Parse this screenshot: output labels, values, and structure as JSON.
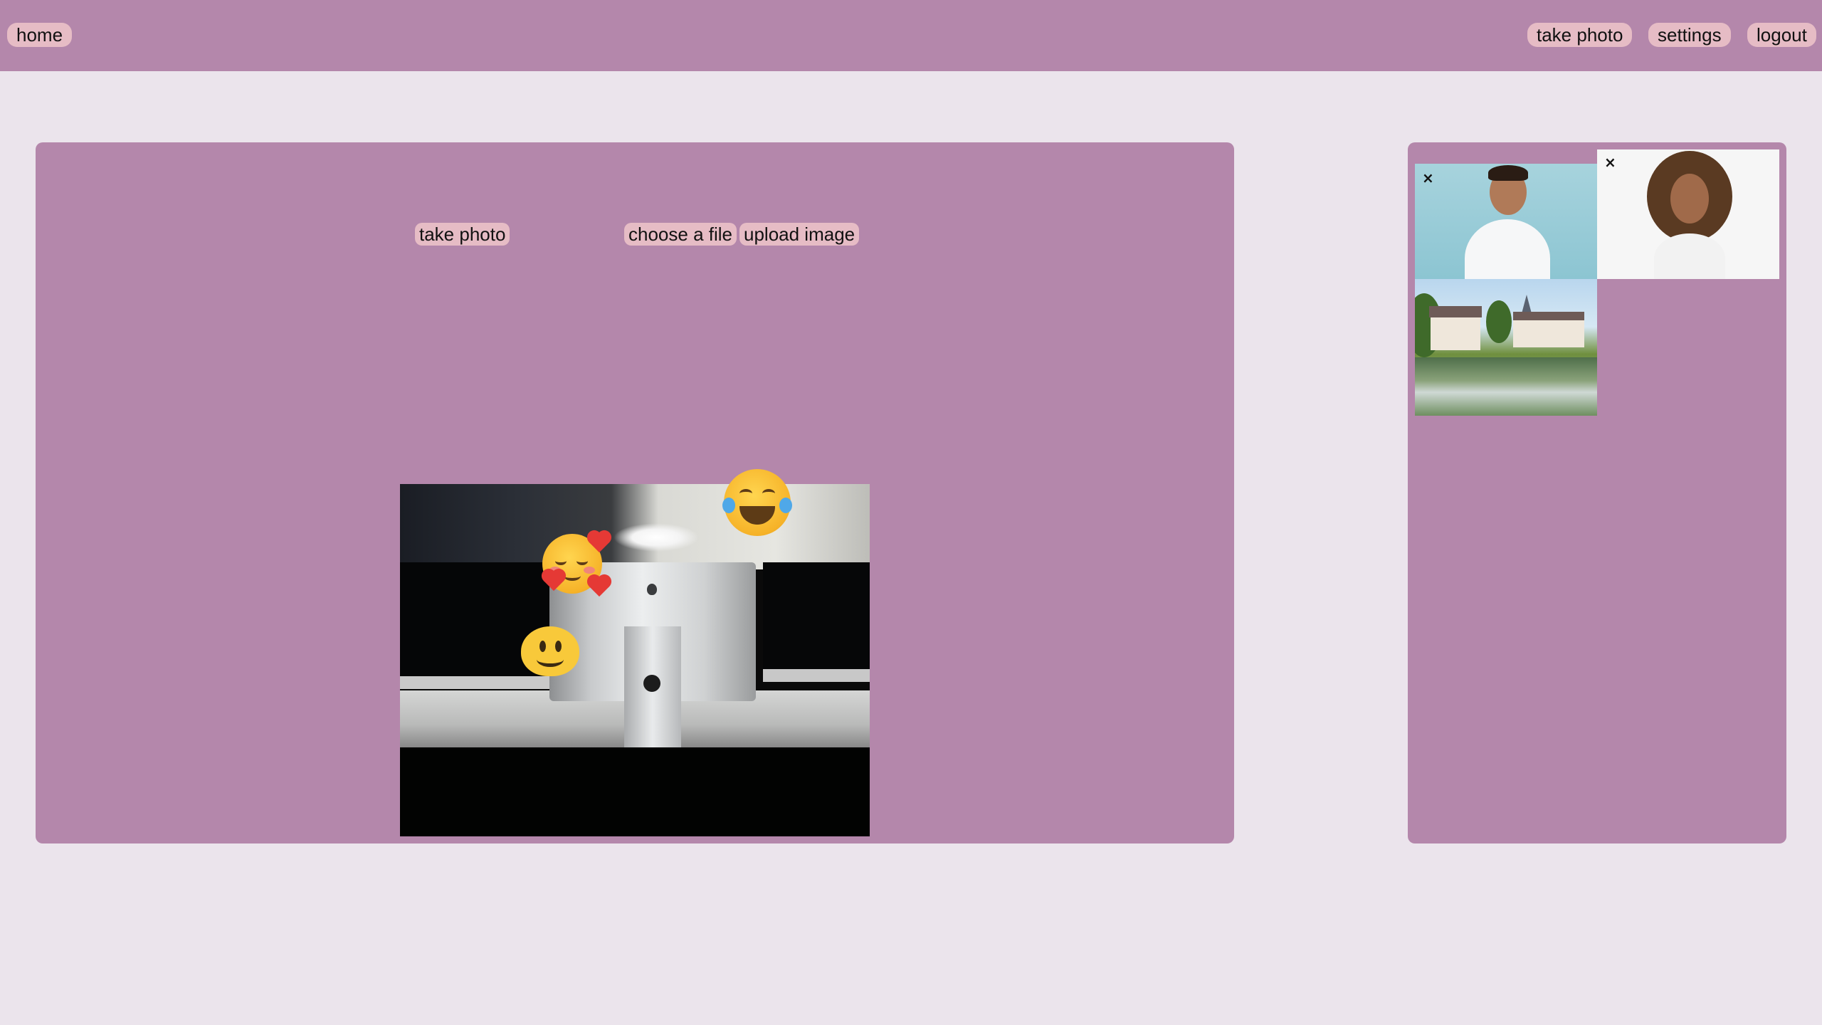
{
  "nav": {
    "home": "home",
    "take_photo": "take photo",
    "settings": "settings",
    "logout": "logout"
  },
  "main": {
    "take_photo_button": "take photo",
    "choose_file_button": "choose a file",
    "upload_image_button": "upload image",
    "preview_stickers": [
      "face-with-tears-of-joy",
      "smiling-face-with-hearts",
      "slightly-smiling-face"
    ]
  },
  "gallery": {
    "items": [
      {
        "subject": "smiling man in white shirt",
        "delete_label": "×"
      },
      {
        "subject": "smiling woman with curly hair",
        "delete_label": "×"
      },
      {
        "subject": "village with church by a pond",
        "delete_label": ""
      }
    ]
  },
  "colors": {
    "page_background": "#ebe4ec",
    "panel": "#b487ab",
    "button": "#e6bcc5"
  }
}
